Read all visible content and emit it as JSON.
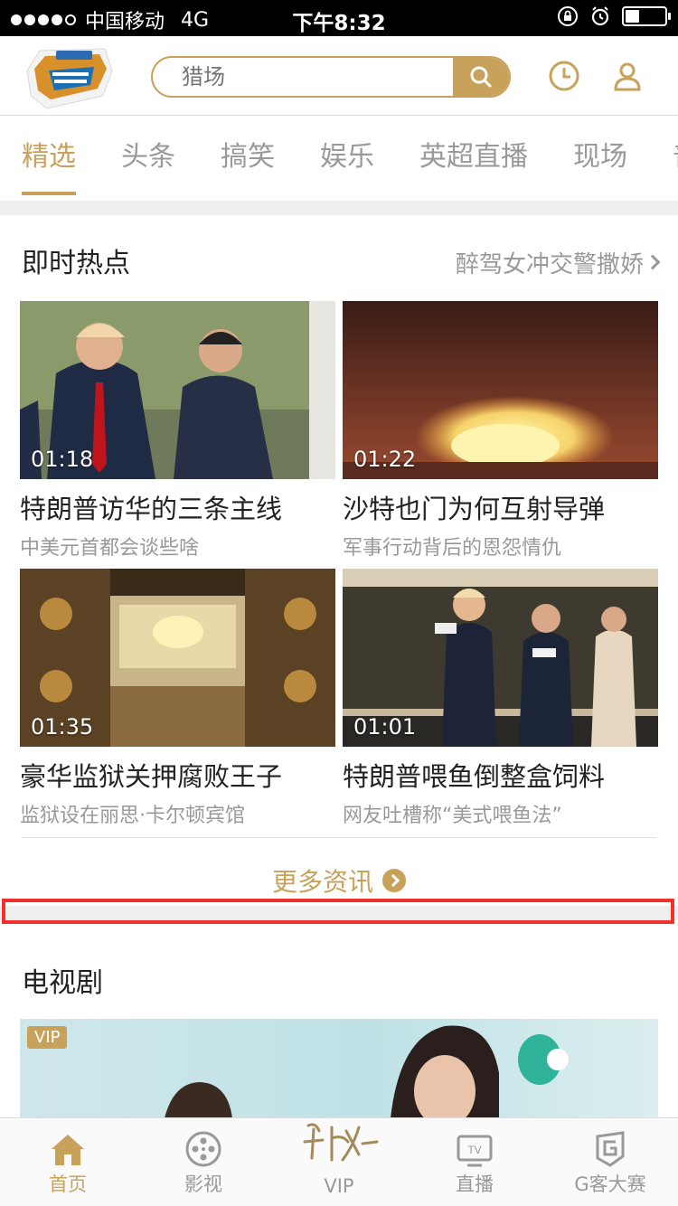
{
  "status_bar": {
    "carrier": "中国移动",
    "network": "4G",
    "time": "下午8:32",
    "battery_level": 0.35
  },
  "header": {
    "search_placeholder": "猎场",
    "icons": [
      "search-icon",
      "clock-icon",
      "user-icon"
    ]
  },
  "tabs": [
    {
      "label": "精选",
      "active": true
    },
    {
      "label": "头条"
    },
    {
      "label": "搞笑"
    },
    {
      "label": "娱乐"
    },
    {
      "label": "英超直播"
    },
    {
      "label": "现场"
    },
    {
      "label": "普"
    }
  ],
  "hot_section": {
    "title": "即时热点",
    "link": "醉驾女冲交警撒娇",
    "videos": [
      {
        "duration": "01:18",
        "title": "特朗普访华的三条主线",
        "subtitle": "中美元首都会谈些啥"
      },
      {
        "duration": "01:22",
        "title": "沙特也门为何互射导弹",
        "subtitle": "军事行动背后的恩怨情仇"
      },
      {
        "duration": "01:35",
        "title": "豪华监狱关押腐败王子",
        "subtitle": "监狱设在丽思·卡尔顿宾馆"
      },
      {
        "duration": "01:01",
        "title": "特朗普喂鱼倒整盒饲料",
        "subtitle": "网友吐槽称“美式喂鱼法”"
      }
    ],
    "more": "更多资讯"
  },
  "tv_section": {
    "title": "电视剧",
    "banner_badge": "VIP"
  },
  "bottom_nav": [
    {
      "label": "首页",
      "active": true
    },
    {
      "label": "影视"
    },
    {
      "label": "VIP"
    },
    {
      "label": "直播"
    },
    {
      "label": "G客大赛"
    }
  ],
  "colors": {
    "accent": "#c8a15a",
    "highlight_box": "#f0322a"
  }
}
